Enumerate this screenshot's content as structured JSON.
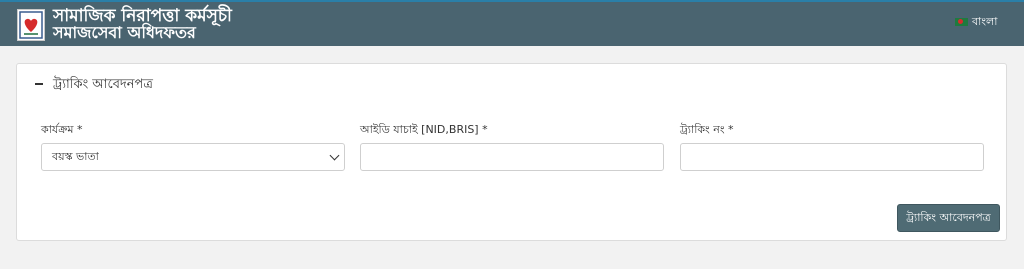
{
  "header": {
    "title_line1": "সামাজিক নিরাপত্তা কর্মসূচী",
    "title_line2": "সমাজসেবা অধিদফতর",
    "language_label": "বাংলা",
    "flag_icon": "bangladesh-flag-icon"
  },
  "form": {
    "section_title": "ট্র্যাকিং আবেদনপত্র",
    "fields": {
      "program": {
        "label": "কার্যক্রম *",
        "value": "বয়স্ক ভাতা"
      },
      "id_verify": {
        "label": "আইডি যাচাই [NID,BRIS] *",
        "value": ""
      },
      "tracking_no": {
        "label": "ট্র্যাকিং নং *",
        "value": ""
      }
    },
    "submit_label": "ট্র্যাকিং আবেদনপত্র"
  },
  "colors": {
    "header_bg": "#4a6470",
    "button_bg": "#4f6b74",
    "page_bg": "#f2f2f2"
  }
}
